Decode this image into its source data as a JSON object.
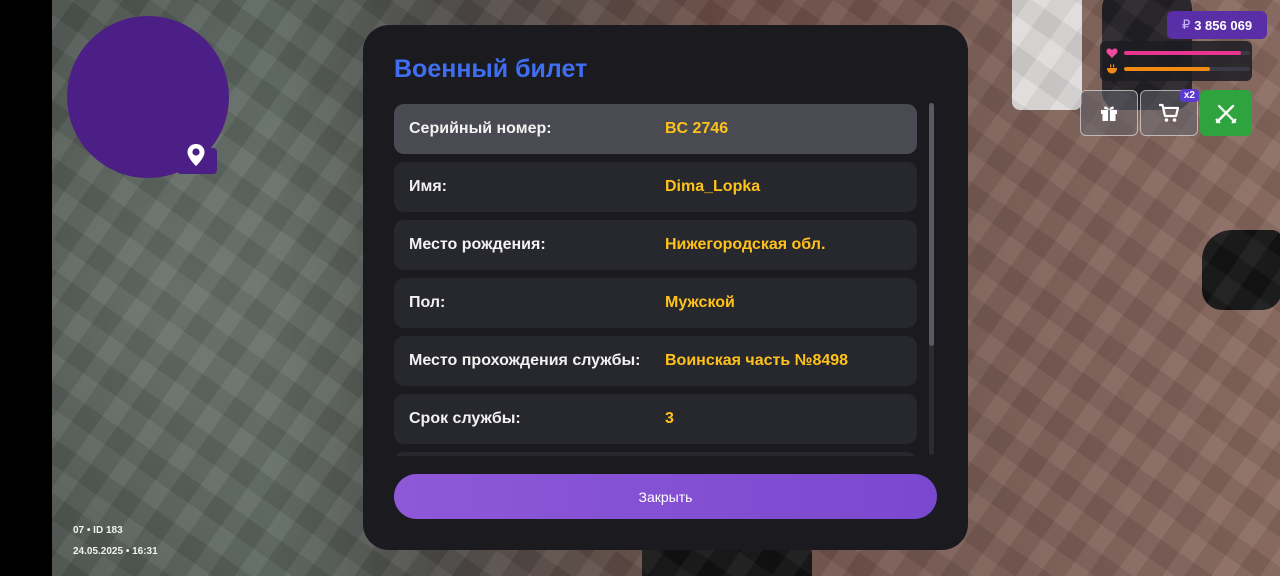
{
  "hud": {
    "minimap_icon": "location-pin-icon",
    "session_line": "07 • ID 183",
    "datetime": "24.05.2025 • 16:31",
    "money": {
      "currency": "₽",
      "amount": "3 856 069"
    },
    "health_level": 0.93,
    "hunger_level": 0.68,
    "health_color": "#e8358f",
    "hunger_color": "#f28a14",
    "shop_multiplier": "x2"
  },
  "modal": {
    "title": "Военный билет",
    "rows": [
      {
        "label": "Серийный номер:",
        "value": "BC 2746"
      },
      {
        "label": "Имя:",
        "value": "Dima_Lopka"
      },
      {
        "label": "Место рождения:",
        "value": "Нижегородская обл."
      },
      {
        "label": "Пол:",
        "value": "Мужской"
      },
      {
        "label": "Место прохождения службы:",
        "value": "Воинская часть №8498"
      },
      {
        "label": "Срок службы:",
        "value": "3"
      }
    ],
    "close_label": "Закрыть"
  },
  "colors": {
    "title": "#3f6ef0",
    "value": "#ffc21a",
    "accent": "#8e58d8",
    "money_bg": "#5a2ea6"
  }
}
